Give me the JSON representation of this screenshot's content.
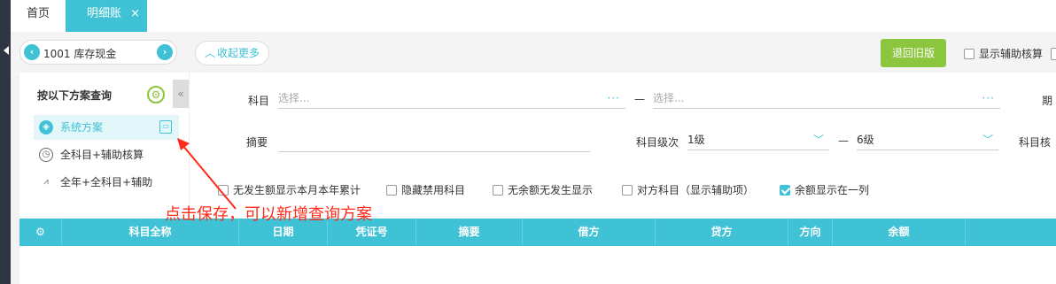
{
  "tabs": {
    "home": "首页",
    "active": "明细账",
    "close_glyph": "×"
  },
  "toolbar": {
    "account_value": "1001 库存现金",
    "collapse_label": "收起更多",
    "old_version_label": "退回旧版",
    "show_aux_label": "显示辅助核算"
  },
  "sidebar": {
    "title": "按以下方案查询",
    "items": [
      {
        "label": "系统方案",
        "icon": "cube-icon"
      },
      {
        "label": "全科目+辅助核算",
        "icon": "clock-icon"
      },
      {
        "label": "全年+全科目+辅助",
        "icon": "chart-icon"
      }
    ]
  },
  "form": {
    "subject_label": "科目",
    "subject_from_placeholder": "选择...",
    "subject_to_placeholder": "选择...",
    "summary_label": "摘要",
    "level_label": "科目级次",
    "level_from": "1级",
    "level_to": "6级",
    "right_cut_label_1": "期",
    "right_cut_label_2": "科目核",
    "range_dash": "—"
  },
  "options": [
    {
      "label": "无发生额显示本月本年累计",
      "checked": false
    },
    {
      "label": "隐藏禁用科目",
      "checked": false
    },
    {
      "label": "无余额无发生显示",
      "checked": false
    },
    {
      "label": "对方科目（显示辅助项）",
      "checked": false
    },
    {
      "label": "余额显示在一列",
      "checked": true
    }
  ],
  "table": {
    "columns": [
      "科目全称",
      "日期",
      "凭证号",
      "摘要",
      "借方",
      "贷方",
      "方向",
      "余额"
    ]
  },
  "annotation": {
    "text": "点击保存，可以新增查询方案"
  },
  "colors": {
    "accent": "#3fc2d5",
    "green": "#8cc63f",
    "annotation_red": "#ff2a1a"
  }
}
